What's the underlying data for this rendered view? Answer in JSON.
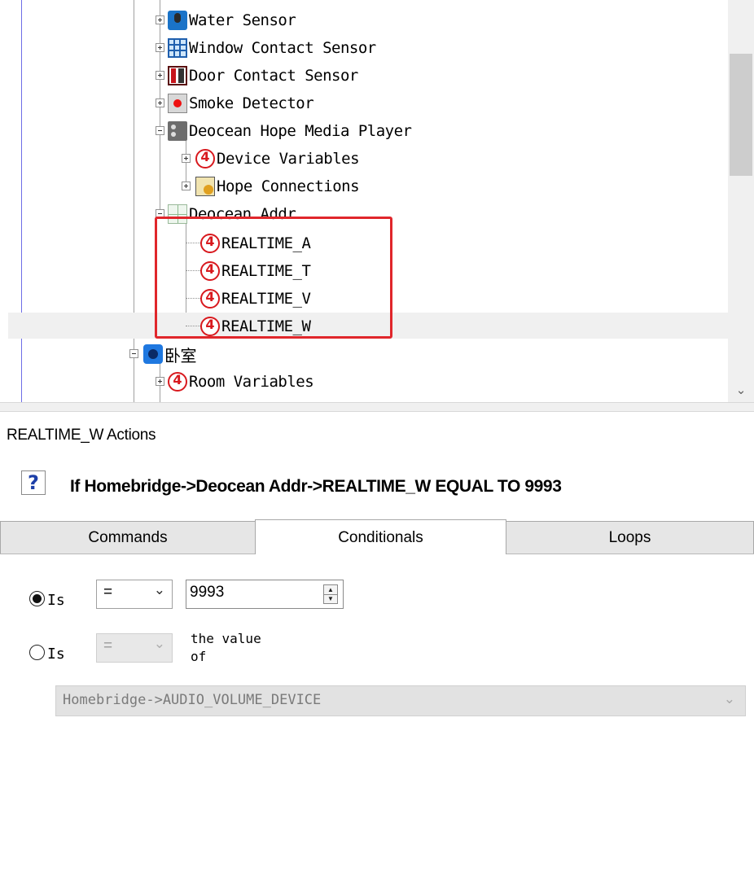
{
  "tree": {
    "items": [
      {
        "label": "Water Sensor",
        "icon": "water-sensor-icon"
      },
      {
        "label": "Window Contact Sensor",
        "icon": "window-contact-icon"
      },
      {
        "label": "Door Contact Sensor",
        "icon": "door-contact-icon"
      },
      {
        "label": "Smoke Detector",
        "icon": "smoke-detector-icon"
      },
      {
        "label": "Deocean Hope Media Player",
        "icon": "media-player-icon"
      },
      {
        "label": "Device Variables",
        "icon": "variable-icon"
      },
      {
        "label": "Hope Connections",
        "icon": "connections-icon"
      },
      {
        "label": "Deocean Addr",
        "icon": "address-icon"
      },
      {
        "label": "REALTIME_A",
        "icon": "variable-icon"
      },
      {
        "label": "REALTIME_T",
        "icon": "variable-icon"
      },
      {
        "label": "REALTIME_V",
        "icon": "variable-icon"
      },
      {
        "label": "REALTIME_W",
        "icon": "variable-icon"
      },
      {
        "label": "卧室",
        "icon": "room-icon"
      },
      {
        "label": "Room Variables",
        "icon": "variable-icon"
      }
    ],
    "selected": "REALTIME_W",
    "highlight_color": "#e0262b"
  },
  "actions": {
    "title": "REALTIME_W Actions",
    "condition": "If Homebridge->Deocean Addr->REALTIME_W EQUAL TO 9993",
    "tabs": [
      {
        "label": "Commands"
      },
      {
        "label": "Conditionals"
      },
      {
        "label": "Loops"
      }
    ],
    "active_tab": "Conditionals",
    "option1": {
      "label": "Is",
      "operator": "=",
      "value": "9993",
      "selected": true
    },
    "option2": {
      "label": "Is",
      "operator": "=",
      "suffix": "the value\nof",
      "selected": false
    },
    "device_select": "Homebridge->AUDIO_VOLUME_DEVICE"
  }
}
